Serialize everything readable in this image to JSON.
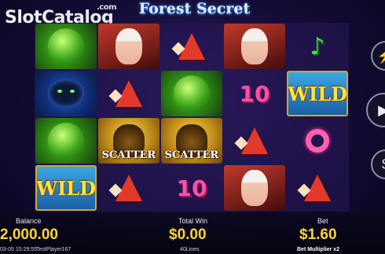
{
  "watermark": {
    "slot": "Slot",
    "catalog": "Catalog",
    "com": ".com"
  },
  "title": "Forest Secret",
  "grid": [
    [
      "snake",
      "girl",
      "A",
      "girl",
      "J"
    ],
    [
      "panther",
      "A",
      "snake",
      "10",
      "wild"
    ],
    [
      "snake",
      "ape",
      "ape",
      "A",
      "Q"
    ],
    [
      "wild",
      "A",
      "10",
      "girl",
      "A"
    ]
  ],
  "labels": {
    "scatter": "SCATTER",
    "wild": "WILD",
    "ten": "10"
  },
  "status": {
    "balance_label": "Balance",
    "balance_value": "2,000.00",
    "total_win_label": "Total Win",
    "total_win_value": "$0.00",
    "bet_label": "Bet",
    "bet_value": "$1.60",
    "lines": "40Lines",
    "bet_multiplier": "Bet Multiplier x2",
    "datetime": "03-05 15:29:55",
    "player": "TestPlayer167"
  },
  "buttons": {
    "turbo_icon": "lightning-icon",
    "spin_icon": "play-icon",
    "bet_icon": "dollar-icon"
  }
}
